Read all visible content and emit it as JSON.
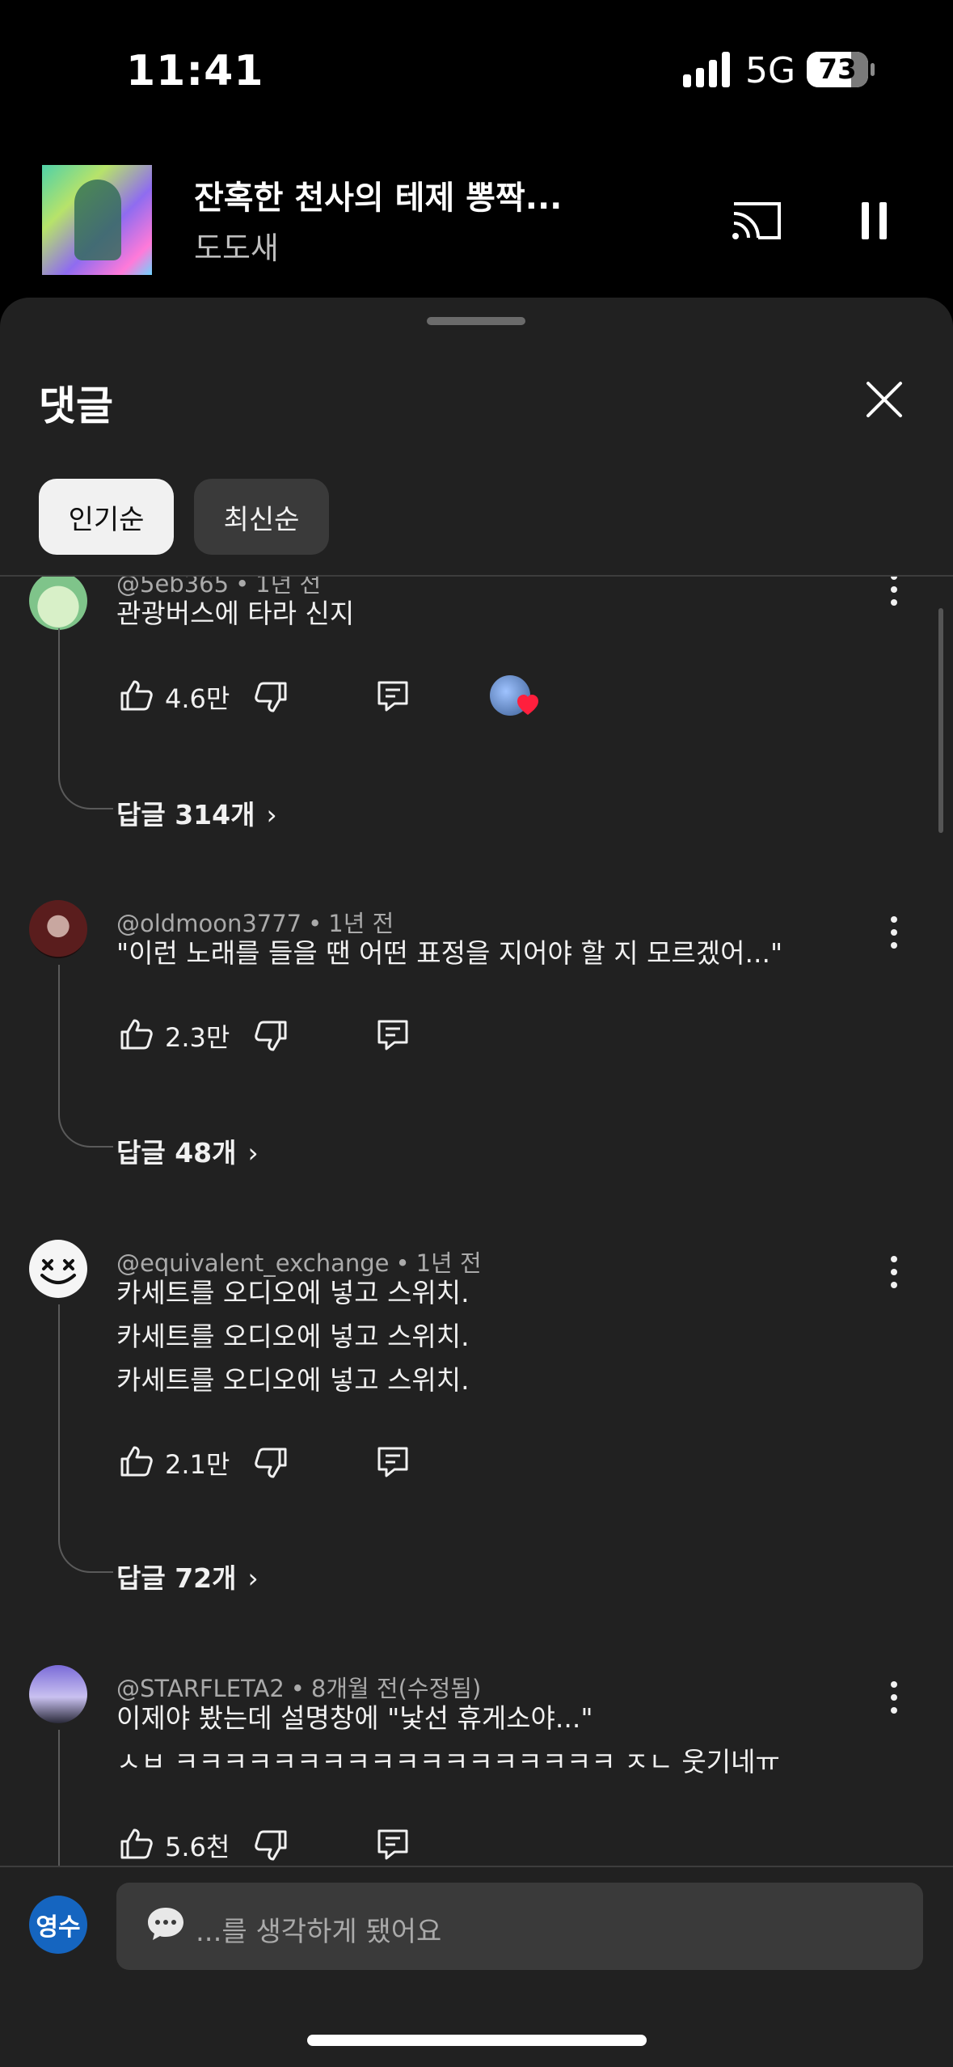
{
  "status_bar": {
    "time": "11:41",
    "network": "5G",
    "battery": "73",
    "battery_level": 0.73
  },
  "mini_player": {
    "title": "잔혹한 천사의 테제 뽕짝...",
    "artist": "도도새"
  },
  "comments_sheet": {
    "title": "댓글",
    "sort_chips": [
      {
        "label": "인기순",
        "selected": true
      },
      {
        "label": "최신순",
        "selected": false
      }
    ],
    "comments": [
      {
        "author": "@5eb365",
        "time": "1년 전",
        "lines": [
          "관광버스에 타라 신지"
        ],
        "likes": "4.6만",
        "replies_label": "답글 314개",
        "creator_heart": true
      },
      {
        "author": "@oldmoon3777",
        "time": "1년 전",
        "lines": [
          "\"이런 노래를 들을 땐 어떤 표정을 지어야 할 지 모르겠어...\""
        ],
        "likes": "2.3만",
        "replies_label": "답글 48개"
      },
      {
        "author": "@equivalent_exchange",
        "time": "1년 전",
        "lines": [
          "카세트를 오디오에 넣고 스위치.",
          "카세트를 오디오에 넣고 스위치.",
          "카세트를 오디오에 넣고 스위치."
        ],
        "likes": "2.1만",
        "replies_label": "답글 72개"
      },
      {
        "author": "@STARFLETA2",
        "time": "8개월 전(수정됨)",
        "lines": [
          "이제야 봤는데 설명창에 \"낯선 휴게소야...\"",
          "ㅅㅂ ㅋㅋㅋㅋㅋㅋㅋㅋㅋㅋㅋㅋㅋㅋㅋㅋㅋㅋ ㅈㄴ 웃기네ㅠ"
        ],
        "likes": "5.6천"
      }
    ]
  },
  "comment_input": {
    "avatar_initials": "영수",
    "placeholder": "...를 생각하게 됐어요"
  },
  "colors": {
    "background": "#000000",
    "sheet": "#212121",
    "chip_active": "#f1f1f1",
    "chip_idle": "#3a3a3a",
    "heart": "#ff1f3d",
    "my_avatar": "#1565c0"
  },
  "icons": [
    "cast-icon",
    "pause-icon",
    "close-icon",
    "like-icon",
    "dislike-icon",
    "reply-icon",
    "more-vert-icon",
    "chevron-right-icon",
    "speech-bubble-icon"
  ]
}
